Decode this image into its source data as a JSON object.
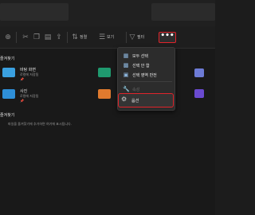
{
  "toolbar": {
    "sort_label": "정렬",
    "view_label": "보기",
    "filter_label": "필터",
    "more_label": "•••",
    "new_label": "새로 만들기"
  },
  "quick_access": {
    "title": "즐겨찾기",
    "items": [
      {
        "name": "바탕 화면",
        "sub": "로컬에 저장됨",
        "color": "#3aa0e0"
      },
      {
        "name": "사진",
        "sub": "로컬에 저장됨",
        "color": "#2e8fd8"
      }
    ],
    "right_items": [
      "",
      "",
      ""
    ]
  },
  "favorites": {
    "title": "즐겨찾기",
    "empty_text": "파일을 즐겨찾기에 추가하면 여기에 표시됩니다."
  },
  "menu": {
    "items": [
      {
        "label": "모두 선택",
        "icon": "select-all-icon",
        "disabled": false
      },
      {
        "label": "선택 안 함",
        "icon": "select-none-icon",
        "disabled": false
      },
      {
        "label": "선택 영역 반전",
        "icon": "invert-selection-icon",
        "disabled": false
      },
      {
        "label": "속성",
        "icon": "properties-icon",
        "disabled": true
      },
      {
        "label": "옵션",
        "icon": "options-icon",
        "disabled": false
      }
    ]
  },
  "colors": {
    "highlight": "#e0242b",
    "folder_green": "#1f9a6f",
    "folder_orange": "#e07a2e",
    "folder_purple": "#6a4ad0"
  }
}
